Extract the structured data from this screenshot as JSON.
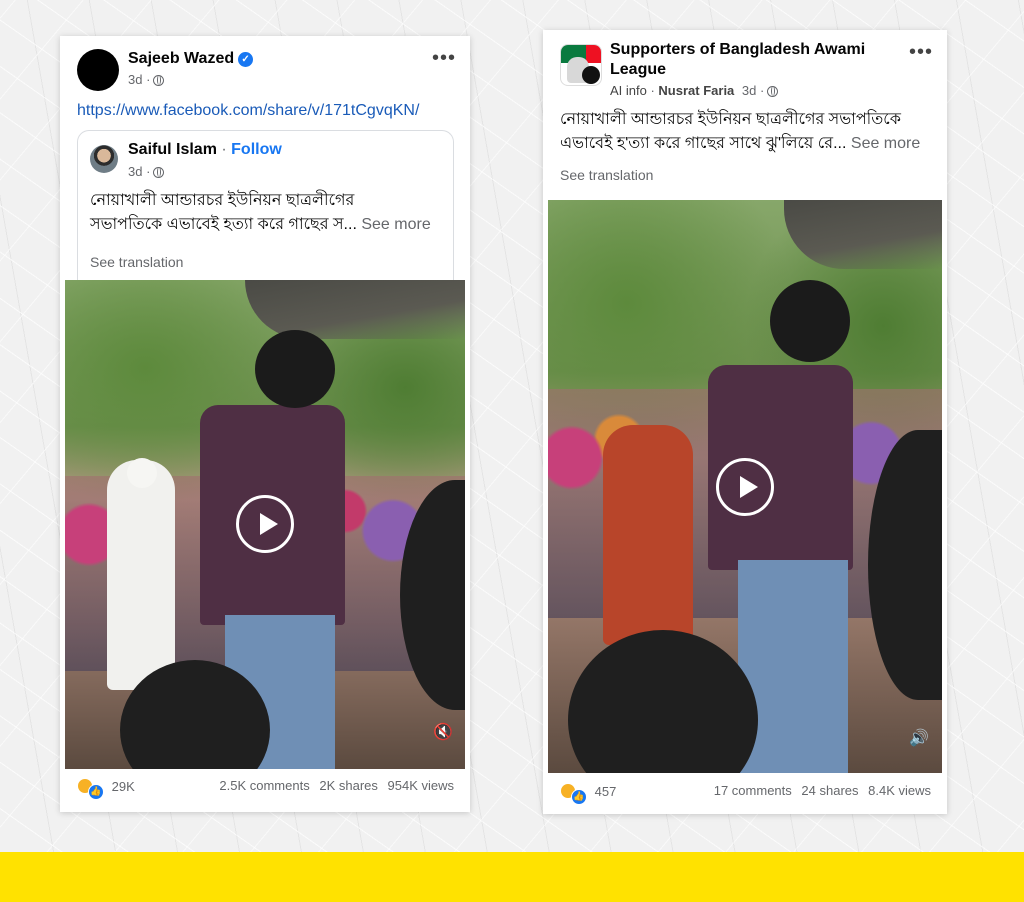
{
  "left_post": {
    "author": "Sajeeb Wazed",
    "time": "3d ·",
    "link": "https://www.facebook.com/share/v/171tCgvqKN/",
    "shared": {
      "author": "Saiful Islam",
      "separator": " · ",
      "follow": "Follow",
      "time": "3d ·",
      "text_line1": "নোয়াখালী আন্ডারচর ইউনিয়ন ছাত্রলীগের",
      "text_line2": "সভাপতিকে এভাবেই হত্যা করে গাছের স...",
      "see_more": "See more",
      "see_translation": "See translation"
    },
    "reaction_count": "29K",
    "comments": "2.5K comments",
    "shares": "2K shares",
    "views": "954K views",
    "volume_icon": "muted"
  },
  "right_post": {
    "page_name_line1": "Supporters of Bangladesh Awami",
    "page_name_line2": "League",
    "ai_info": "AI info",
    "dot": " · ",
    "author": "Nusrat Faria",
    "time": "3d ·",
    "text_line1": "নোয়াখালী আন্ডারচর ইউনিয়ন ছাত্রলীগের সভাপতিকে",
    "text_line2": "এভাবেই হ'ত্যা করে গাছের সাথে ঝু'লিয়ে রে...",
    "see_more": "See more",
    "see_translation": "See translation",
    "reaction_count": "457",
    "comments": "17 comments",
    "shares": "24 shares",
    "views": "8.4K views",
    "volume_icon": "unmuted"
  },
  "icons": {
    "more": "•••",
    "verified": "✓",
    "muted": "🔇",
    "unmuted": "🔊",
    "like": "👍"
  },
  "colors": {
    "accent_band": "#ffe200",
    "link": "#1a5bb8",
    "facebook_blue": "#1877f2"
  }
}
